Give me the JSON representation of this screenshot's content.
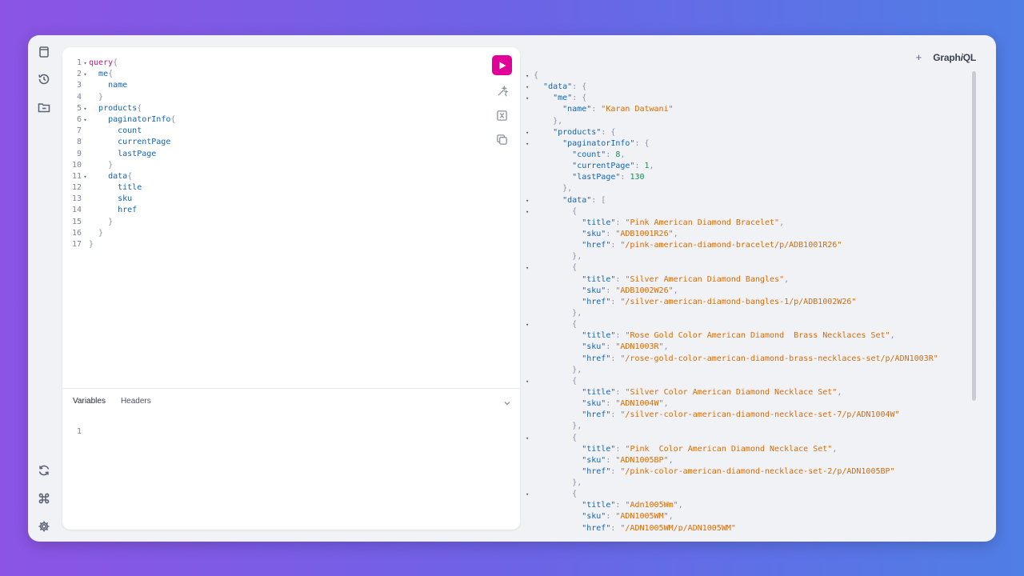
{
  "app": {
    "brand_prefix": "Graph",
    "brand_italic": "i",
    "brand_suffix": "QL",
    "plus_label": "+"
  },
  "sidebar": {
    "top_icons": [
      "docs-icon",
      "history-icon",
      "explorer-icon"
    ],
    "bottom_icons": [
      "refetch-schema-icon",
      "shortcuts-icon",
      "settings-icon"
    ]
  },
  "query_lines": [
    {
      "n": "1",
      "fold": "▾",
      "indent": 0,
      "tokens": [
        [
          "kw",
          "query"
        ],
        [
          "p",
          "{"
        ]
      ]
    },
    {
      "n": "2",
      "fold": "▾",
      "indent": 1,
      "tokens": [
        [
          "f",
          "me"
        ],
        [
          "p",
          "{"
        ]
      ]
    },
    {
      "n": "3",
      "fold": "",
      "indent": 2,
      "tokens": [
        [
          "f",
          "name"
        ]
      ]
    },
    {
      "n": "4",
      "fold": "",
      "indent": 1,
      "tokens": [
        [
          "p",
          "}"
        ]
      ]
    },
    {
      "n": "5",
      "fold": "▾",
      "indent": 1,
      "tokens": [
        [
          "f",
          "products"
        ],
        [
          "p",
          "{"
        ]
      ]
    },
    {
      "n": "6",
      "fold": "▾",
      "indent": 2,
      "tokens": [
        [
          "f",
          "paginatorInfo"
        ],
        [
          "p",
          "{"
        ]
      ]
    },
    {
      "n": "7",
      "fold": "",
      "indent": 3,
      "tokens": [
        [
          "f",
          "count"
        ]
      ]
    },
    {
      "n": "8",
      "fold": "",
      "indent": 3,
      "tokens": [
        [
          "f",
          "currentPage"
        ]
      ]
    },
    {
      "n": "9",
      "fold": "",
      "indent": 3,
      "tokens": [
        [
          "f",
          "lastPage"
        ]
      ]
    },
    {
      "n": "10",
      "fold": "",
      "indent": 2,
      "tokens": [
        [
          "p",
          "}"
        ]
      ]
    },
    {
      "n": "11",
      "fold": "▾",
      "indent": 2,
      "tokens": [
        [
          "f",
          "data"
        ],
        [
          "p",
          "{"
        ]
      ]
    },
    {
      "n": "12",
      "fold": "",
      "indent": 3,
      "tokens": [
        [
          "f",
          "title"
        ]
      ]
    },
    {
      "n": "13",
      "fold": "",
      "indent": 3,
      "tokens": [
        [
          "f",
          "sku"
        ]
      ]
    },
    {
      "n": "14",
      "fold": "",
      "indent": 3,
      "tokens": [
        [
          "f",
          "href"
        ]
      ]
    },
    {
      "n": "15",
      "fold": "",
      "indent": 2,
      "tokens": [
        [
          "p",
          "}"
        ]
      ]
    },
    {
      "n": "16",
      "fold": "",
      "indent": 1,
      "tokens": [
        [
          "p",
          "}"
        ]
      ]
    },
    {
      "n": "17",
      "fold": "",
      "indent": 0,
      "tokens": [
        [
          "p",
          "}"
        ]
      ]
    }
  ],
  "variables_panel": {
    "tabs": [
      "Variables",
      "Headers"
    ],
    "active_tab": "Variables",
    "lines": [
      "1"
    ]
  },
  "response": {
    "me": {
      "name": "Karan Datwani"
    },
    "paginatorInfo": {
      "count": 8,
      "currentPage": 1,
      "lastPage": 130
    },
    "products": [
      {
        "title": "Pink American Diamond Bracelet",
        "sku": "ADB1001R26",
        "href": "/pink-american-diamond-bracelet/p/ADB1001R26"
      },
      {
        "title": "Silver American Diamond Bangles",
        "sku": "ADB1002W26",
        "href": "/silver-american-diamond-bangles-1/p/ADB1002W26"
      },
      {
        "title": "Rose Gold Color American Diamond  Brass Necklaces Set",
        "sku": "ADN1003R",
        "href": "/rose-gold-color-american-diamond-brass-necklaces-set/p/ADN1003R"
      },
      {
        "title": "Silver Color American Diamond Necklace Set",
        "sku": "ADN1004W",
        "href": "/silver-color-american-diamond-necklace-set-7/p/ADN1004W"
      },
      {
        "title": "Pink  Color American Diamond Necklace Set",
        "sku": "ADN1005BP",
        "href": "/pink-color-american-diamond-necklace-set-2/p/ADN1005BP"
      },
      {
        "title": "Adn1005Wm",
        "sku": "ADN1005WM",
        "href": "/ADN1005WM/p/ADN1005WM"
      }
    ]
  }
}
